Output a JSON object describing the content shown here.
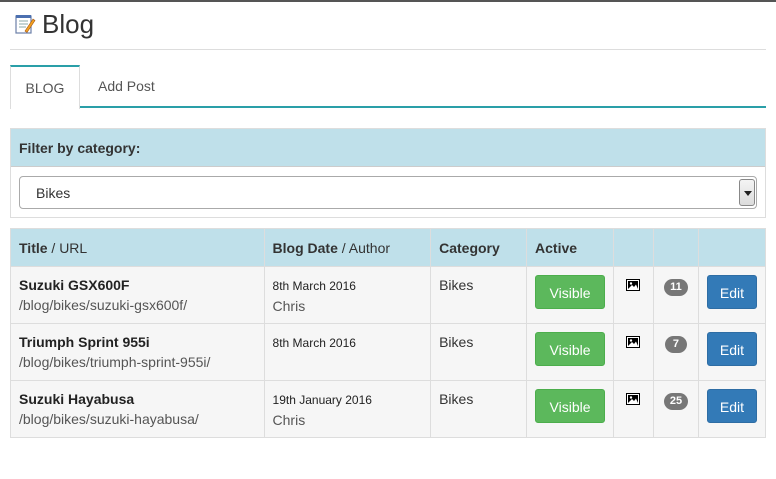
{
  "page": {
    "title": "Blog"
  },
  "tabs": [
    {
      "label": "BLOG",
      "active": true
    },
    {
      "label": "Add Post",
      "active": false
    }
  ],
  "filter": {
    "heading": "Filter by category:",
    "selected": "Bikes"
  },
  "table": {
    "headers": {
      "title": "Title",
      "url": " / URL",
      "date": "Blog Date",
      "author": " / Author",
      "category": "Category",
      "active": "Active"
    },
    "rows": [
      {
        "title": "Suzuki GSX600F",
        "url": "/blog/bikes/suzuki-gsx600f/",
        "date": "8th March 2016",
        "author": "Chris",
        "category": "Bikes",
        "status": "Visible",
        "count": "11",
        "edit": "Edit"
      },
      {
        "title": "Triumph Sprint 955i",
        "url": "/blog/bikes/triumph-sprint-955i/",
        "date": "8th March 2016",
        "author": "",
        "category": "Bikes",
        "status": "Visible",
        "count": "7",
        "edit": "Edit"
      },
      {
        "title": "Suzuki Hayabusa",
        "url": "/blog/bikes/suzuki-hayabusa/",
        "date": "19th January 2016",
        "author": "Chris",
        "category": "Bikes",
        "status": "Visible",
        "count": "25",
        "edit": "Edit"
      }
    ]
  },
  "colors": {
    "accent": "#2a9fa8",
    "panel": "#bfe0ea",
    "success": "#5cb85c",
    "primary": "#337ab7",
    "badge": "#777777"
  },
  "icons": {
    "page": "notepad-icon",
    "image": "image-icon"
  }
}
